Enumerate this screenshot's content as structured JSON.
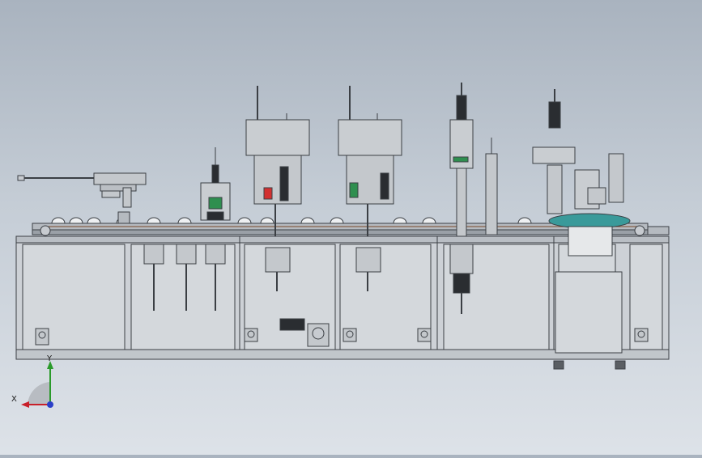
{
  "viewport": {
    "background_top": "#a9b3bf",
    "background_bottom": "#dde2e8",
    "line_color": "#3b3f44",
    "frame_fill": "#c7cbd0"
  },
  "triad": {
    "x_label": "X",
    "y_label": "Y",
    "x_color": "#c8202a",
    "y_color": "#2a9a2a",
    "z_color": "#2a3fc8"
  },
  "colors": {
    "bowl_feeder": "#3a9a9a",
    "red_part": "#d23030",
    "green_part": "#2f8f4f",
    "dark_part": "#2a2d31"
  }
}
